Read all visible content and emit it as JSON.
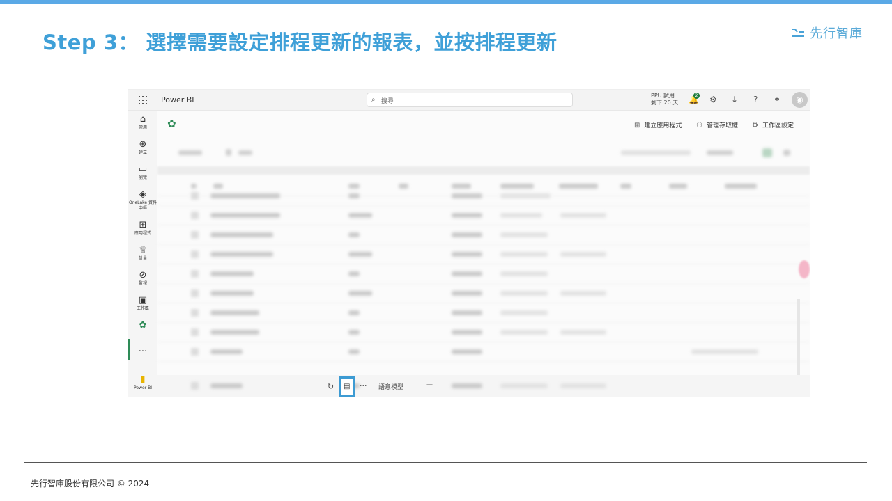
{
  "slide": {
    "title": "Step 3： 選擇需要設定排程更新的報表，並按排程更新",
    "logo_text": "先行智庫",
    "footer": "先行智庫股份有限公司 © 2024"
  },
  "powerbi": {
    "brand": "Power BI",
    "search_placeholder": "搜尋",
    "trial_line1": "PPU 試用...",
    "trial_line2": "剩下 20 天",
    "notification_count": "2",
    "nav": [
      {
        "label": "常用"
      },
      {
        "label": "建立"
      },
      {
        "label": "瀏覽"
      },
      {
        "label": "OneLake 資料中樞"
      },
      {
        "label": "應用程式"
      },
      {
        "label": "計量"
      },
      {
        "label": "監視"
      },
      {
        "label": "工作區"
      },
      {
        "label": "Power BI"
      }
    ],
    "actions": {
      "create_app": "建立應用程式",
      "manage_access": "管理存取權",
      "workspace_settings": "工作區設定"
    },
    "selected_row": {
      "type_label": "語意模型",
      "dash": "—"
    }
  },
  "colors": {
    "title": "#3fa0d8",
    "highlight": "#3d9bd3",
    "top_bar": "#5aa9e6"
  }
}
